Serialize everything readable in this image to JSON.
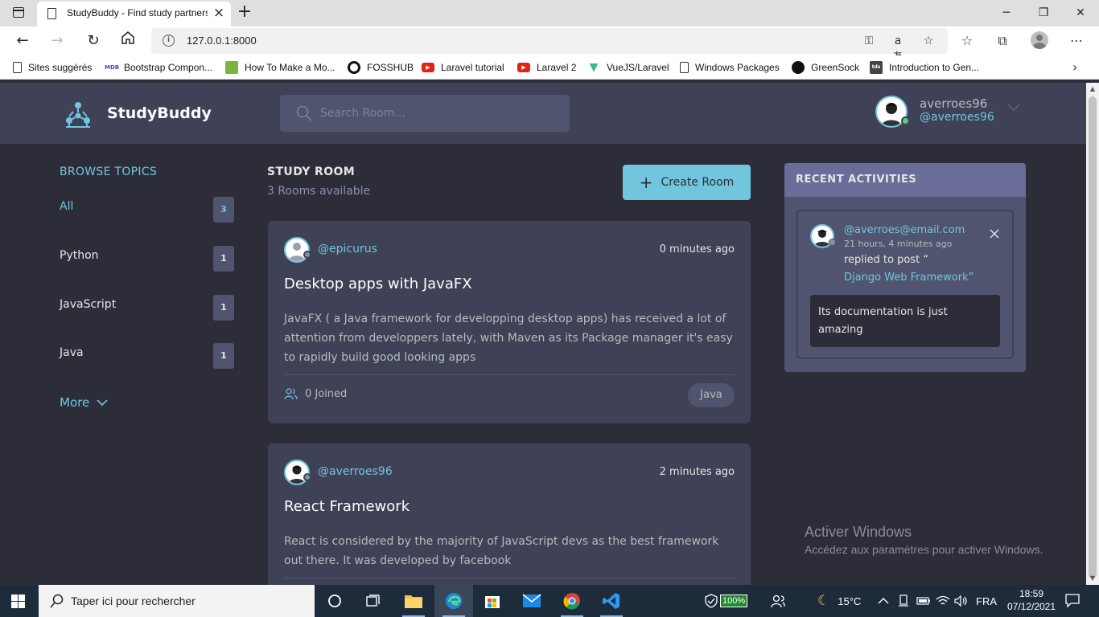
{
  "browser": {
    "tab_title": "StudyBuddy - Find study partners",
    "url": "127.0.0.1:8000",
    "bookmarks": [
      {
        "label": "Sites suggérés",
        "color": "#ffffff",
        "icon": "page-icon"
      },
      {
        "label": "Bootstrap Compon...",
        "color": "#3f51b5",
        "icon": "mdb-icon"
      },
      {
        "label": "How To Make a Mo...",
        "color": "#7cb342",
        "icon": "leaf-icon"
      },
      {
        "label": "FOSSHUB",
        "color": "#111111",
        "icon": "circle-icon"
      },
      {
        "label": "Laravel tutorial",
        "color": "#e62117",
        "icon": "youtube-icon"
      },
      {
        "label": "Laravel 2",
        "color": "#e62117",
        "icon": "youtube-icon"
      },
      {
        "label": "VueJS/Laravel",
        "color": "#41b883",
        "icon": "vue-icon"
      },
      {
        "label": "Windows Packages",
        "color": "#ffffff",
        "icon": "page-icon"
      },
      {
        "label": "GreenSock",
        "color": "#111111",
        "icon": "greensock-icon"
      },
      {
        "label": "Introduction to Gen...",
        "color": "#444444",
        "icon": "tds-icon"
      }
    ]
  },
  "header": {
    "brand": "StudyBuddy",
    "search_placeholder": "Search Room...",
    "user_name": "averroes96",
    "user_handle": "@averroes96"
  },
  "topics": {
    "title": "BROWSE TOPICS",
    "items": [
      {
        "name": "All",
        "count": "3"
      },
      {
        "name": "Python",
        "count": "1"
      },
      {
        "name": "JavaScript",
        "count": "1"
      },
      {
        "name": "Java",
        "count": "1"
      }
    ],
    "more_label": "More"
  },
  "rooms": {
    "heading": "STUDY ROOM",
    "available": "3 Rooms available",
    "create_label": "Create Room",
    "items": [
      {
        "host": "@epicurus",
        "time": "0 minutes ago",
        "title": "Desktop apps with JavaFX",
        "description": "JavaFX ( a Java framework for developping desktop apps) has received a lot of attention from developpers lately, with Maven as its Package manager it's easy to rapidly build good looking apps",
        "joined": "0 Joined",
        "topic": "Java"
      },
      {
        "host": "@averroes96",
        "time": "2 minutes ago",
        "title": "React Framework",
        "description": "React is considered by the majority of JavaScript devs as the best framework out there. It was developed by facebook"
      }
    ]
  },
  "activities": {
    "title": "RECENT ACTIVITIES",
    "items": [
      {
        "user": "@averroes@email.com",
        "time": "21 hours, 4 minutes ago",
        "action": "replied to post “",
        "post": "Django Web Framework”",
        "message": "Its documentation is just amazing"
      }
    ]
  },
  "watermark": {
    "title": "Activer Windows",
    "subtitle": "Accédez aux paramètres pour activer Windows."
  },
  "taskbar": {
    "search_placeholder": "Taper ici pour rechercher",
    "battery": "100%",
    "weather": "15°C",
    "language": "FRA",
    "time": "18:59",
    "date": "07/12/2021"
  },
  "colors": {
    "accent": "#71c6dd",
    "header_bg": "#3f4156",
    "page_bg": "#2d2d39",
    "activity_head": "#696d97"
  }
}
